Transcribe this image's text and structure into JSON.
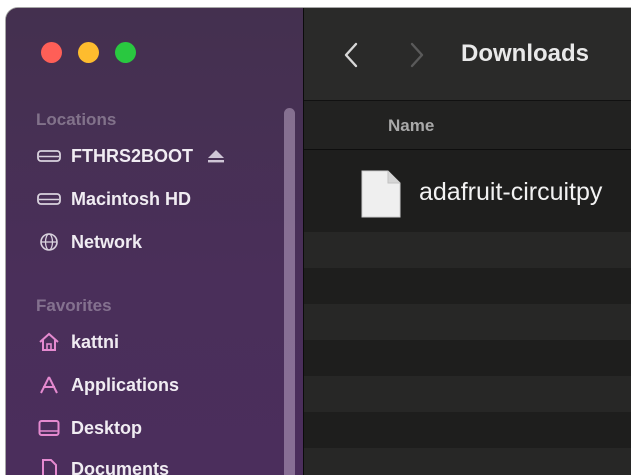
{
  "window": {
    "title": "Downloads"
  },
  "sidebar": {
    "sections": [
      {
        "label": "Locations",
        "items": [
          {
            "label": "FTHRS2BOOT",
            "icon": "external-drive-icon",
            "ejectable": true
          },
          {
            "label": "Macintosh HD",
            "icon": "internal-drive-icon"
          },
          {
            "label": "Network",
            "icon": "network-globe-icon"
          }
        ]
      },
      {
        "label": "Favorites",
        "items": [
          {
            "label": "kattni",
            "icon": "home-icon"
          },
          {
            "label": "Applications",
            "icon": "applications-icon"
          },
          {
            "label": "Desktop",
            "icon": "desktop-icon"
          },
          {
            "label": "Documents",
            "icon": "document-icon"
          }
        ]
      }
    ]
  },
  "file_list": {
    "columns": [
      {
        "label": "Name"
      }
    ],
    "files": [
      {
        "name": "adafruit-circuitpy",
        "icon": "generic-file-icon"
      }
    ]
  },
  "colors": {
    "sidebar": "#4a2f5a",
    "traffic_red": "#fe5f57",
    "traffic_yellow": "#febc2e",
    "traffic_green": "#29c840"
  }
}
